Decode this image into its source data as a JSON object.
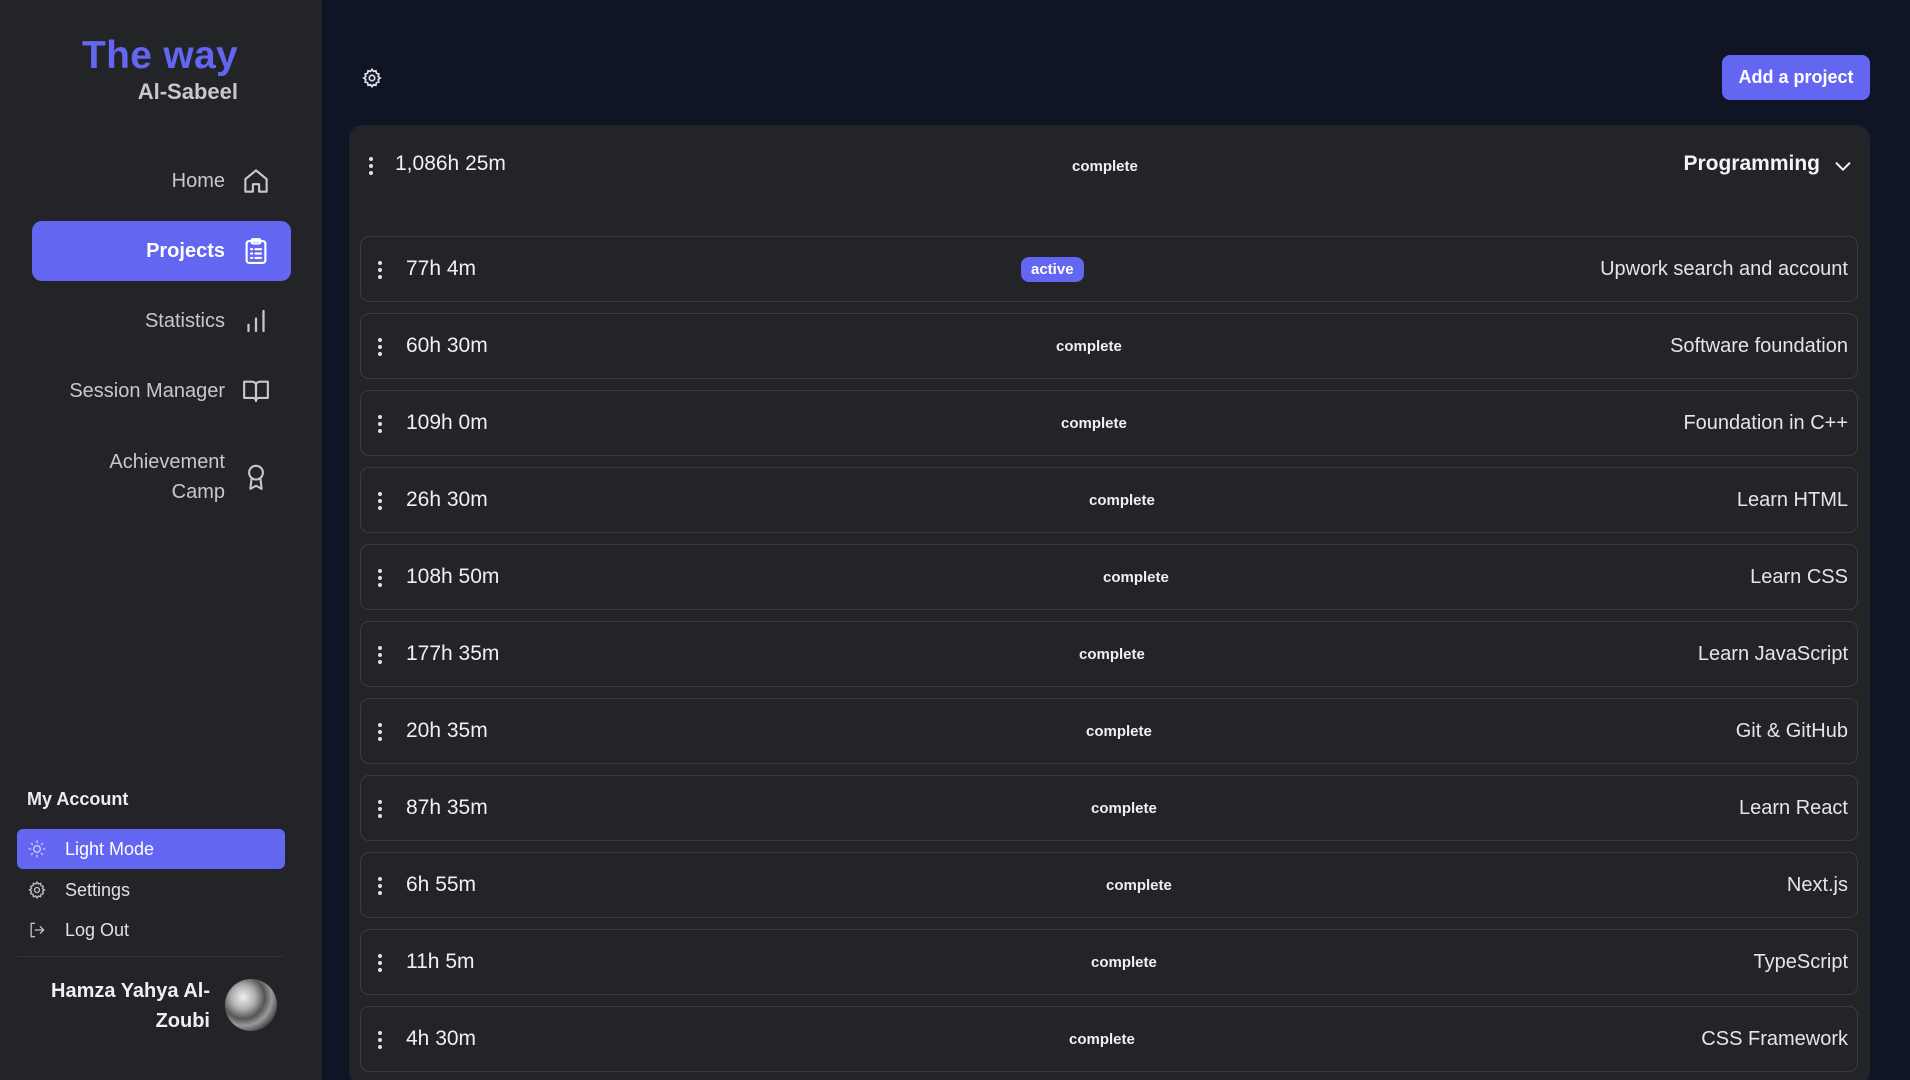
{
  "brand": {
    "title": "The way",
    "subtitle": "Al-Sabeel"
  },
  "nav": [
    {
      "label": "Home",
      "icon": "home-icon",
      "active": false
    },
    {
      "label": "Projects",
      "icon": "clipboard-icon",
      "active": true
    },
    {
      "label": "Statistics",
      "icon": "bar-chart-icon",
      "active": false
    },
    {
      "label": "Session Manager",
      "icon": "book-icon",
      "active": false
    },
    {
      "label": "Achievement Camp",
      "icon": "award-icon",
      "active": false
    }
  ],
  "account": {
    "heading": "My Account",
    "items": [
      {
        "label": "Light Mode",
        "icon": "sun-icon",
        "active": true
      },
      {
        "label": "Settings",
        "icon": "gear-icon",
        "active": false
      },
      {
        "label": "Log Out",
        "icon": "logout-icon",
        "active": false
      }
    ],
    "user_name": "Hamza Yahya Al-Zoubi"
  },
  "toolbar": {
    "add_label": "Add a project"
  },
  "group": {
    "time": "1,086h 25m",
    "status": "complete",
    "name": "Programming"
  },
  "projects": [
    {
      "time": "77h 4m",
      "status": "active",
      "title": "Upwork search and account"
    },
    {
      "time": "60h 30m",
      "status": "complete",
      "title": "Software foundation"
    },
    {
      "time": "109h 0m",
      "status": "complete",
      "title": "Foundation in C++"
    },
    {
      "time": "26h 30m",
      "status": "complete",
      "title": "Learn HTML"
    },
    {
      "time": "108h 50m",
      "status": "complete",
      "title": "Learn CSS"
    },
    {
      "time": "177h 35m",
      "status": "complete",
      "title": "Learn JavaScript"
    },
    {
      "time": "20h 35m",
      "status": "complete",
      "title": "Git & GitHub"
    },
    {
      "time": "87h 35m",
      "status": "complete",
      "title": "Learn React"
    },
    {
      "time": "6h 55m",
      "status": "complete",
      "title": "Next.js"
    },
    {
      "time": "11h 5m",
      "status": "complete",
      "title": "TypeScript"
    },
    {
      "time": "4h 30m",
      "status": "complete",
      "title": "CSS Framework"
    }
  ],
  "colors": {
    "accent": "#6366f1",
    "background": "#0f1524",
    "panel": "#232428"
  }
}
